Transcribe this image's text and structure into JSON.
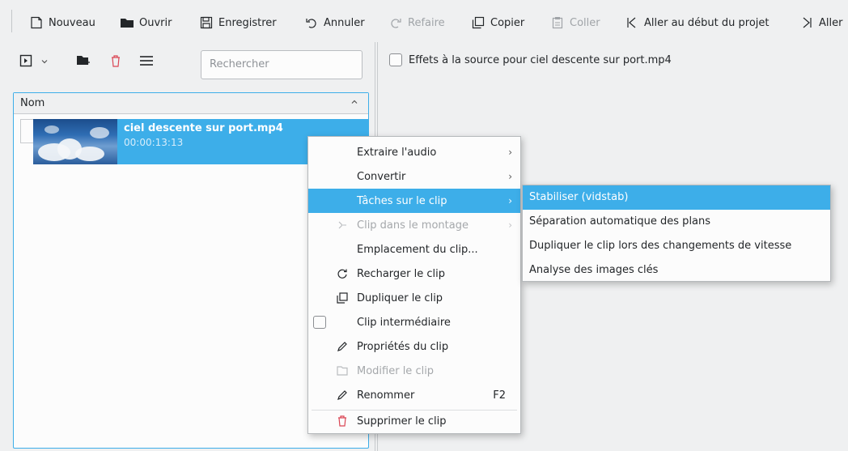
{
  "toolbar": {
    "new_label": "Nouveau",
    "open_label": "Ouvrir",
    "save_label": "Enregistrer",
    "undo_label": "Annuler",
    "redo_label": "Refaire",
    "copy_label": "Copier",
    "paste_label": "Coller",
    "goto_start_label": "Aller au début du projet",
    "goto_end_label": "Aller"
  },
  "bin": {
    "search_placeholder": "Rechercher",
    "column_header": "Nom",
    "clip": {
      "name": "ciel descente sur port.mp4",
      "duration": "00:00:13:13"
    }
  },
  "effects": {
    "label": "Effets à la source pour ciel descente sur port.mp4"
  },
  "context_menu": {
    "items": [
      {
        "label": "Extraire l'audio",
        "submenu": true
      },
      {
        "label": "Convertir",
        "submenu": true
      },
      {
        "label": "Tâches sur le clip",
        "submenu": true,
        "active": true
      },
      {
        "label": "Clip dans le montage",
        "submenu": true,
        "disabled": true
      },
      {
        "label": "Emplacement du clip..."
      },
      {
        "label": "Recharger le clip",
        "icon": "reload-icon"
      },
      {
        "label": "Dupliquer le clip",
        "icon": "duplicate-icon"
      },
      {
        "label": "Clip intermédiaire",
        "checkbox": true,
        "checked": false
      },
      {
        "label": "Propriétés du clip",
        "icon": "edit-icon"
      },
      {
        "label": "Modifier le clip",
        "icon": "folder-icon",
        "disabled": true
      },
      {
        "label": "Renommer",
        "icon": "edit-icon",
        "shortcut": "F2"
      },
      {
        "label": "Supprimer le clip",
        "icon": "trash-icon"
      }
    ]
  },
  "submenu": {
    "items": [
      {
        "label": "Stabiliser (vidstab)",
        "active": true
      },
      {
        "label": "Séparation automatique des plans"
      },
      {
        "label": "Dupliquer le clip lors des changements de vitesse"
      },
      {
        "label": "Analyse des images clés"
      }
    ]
  },
  "colors": {
    "accent": "#3daee9",
    "delete": "#da4453",
    "window_bg": "#eff0f1",
    "view_bg": "#fcfcfc"
  }
}
